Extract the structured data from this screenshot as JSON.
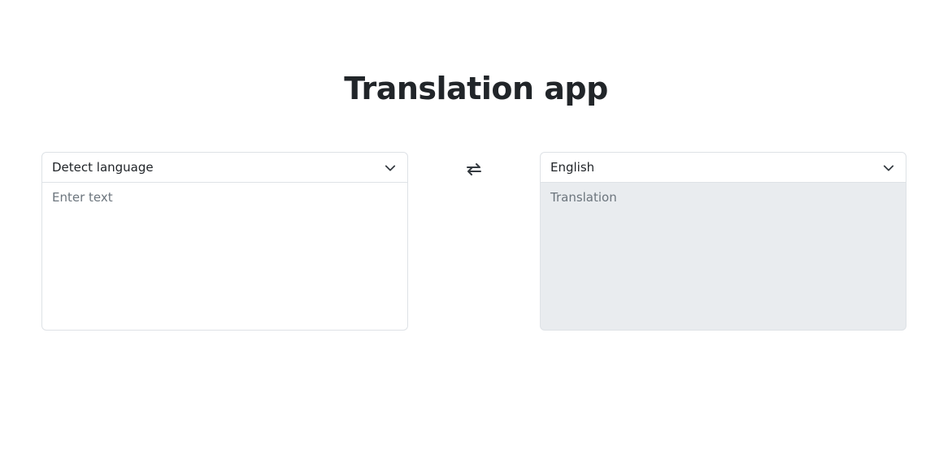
{
  "header": {
    "title": "Translation app"
  },
  "source": {
    "language_selected": "Detect language",
    "text_placeholder": "Enter text",
    "text_value": ""
  },
  "swap": {
    "icon": "swap-arrows-icon"
  },
  "target": {
    "language_selected": "English",
    "text_placeholder": "Translation",
    "text_value": ""
  },
  "colors": {
    "text": "#212529",
    "border": "#dee2e6",
    "readonly_bg": "#e9ecef",
    "placeholder": "#6c757d"
  }
}
